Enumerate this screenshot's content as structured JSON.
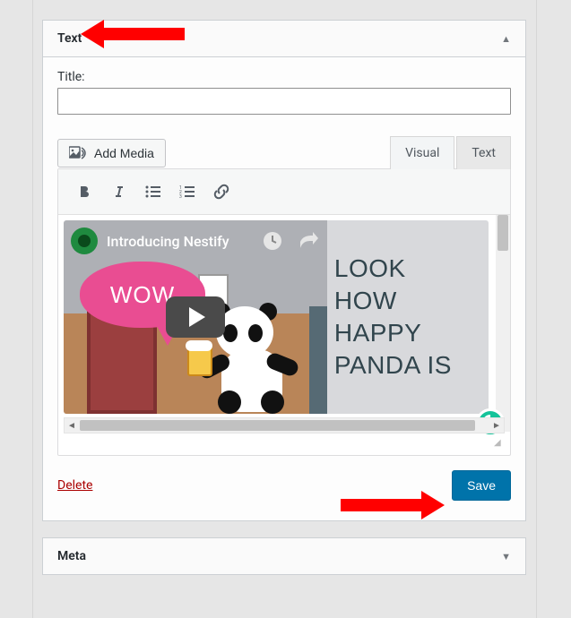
{
  "widgets": {
    "text": {
      "title": "Text",
      "title_label": "Title:",
      "title_value": "",
      "add_media_label": "Add Media",
      "tabs": {
        "visual": "Visual",
        "text": "Text"
      },
      "video": {
        "channel_title": "Introducing Nestify",
        "bubble": "WOW",
        "lines": [
          "LOOK",
          "HOW",
          "HAPPY",
          "PANDA IS"
        ]
      },
      "delete_label": "Delete",
      "save_label": "Save"
    },
    "meta": {
      "title": "Meta"
    }
  },
  "icons": {
    "media": "media-icon",
    "bold": "bold-icon",
    "italic": "italic-icon",
    "ul": "bullet-list-icon",
    "ol": "number-list-icon",
    "link": "link-icon",
    "watch_later": "watch-later-icon",
    "share": "share-icon",
    "grammarly": "grammarly-icon"
  }
}
